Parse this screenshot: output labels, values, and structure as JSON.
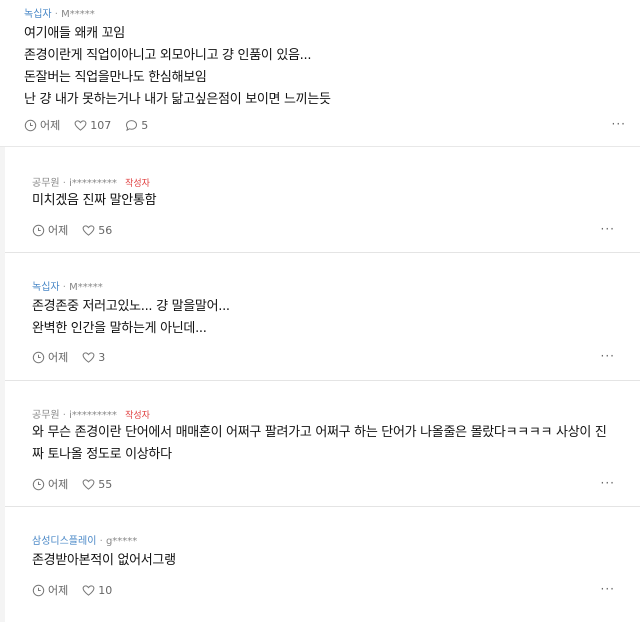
{
  "post_comment": {
    "company": "녹십자",
    "user": "M*****",
    "lines": [
      "여기애들 왜캐 꼬임",
      "존경이란게 직업이아니고 외모아니고 걍 인품이 있음...",
      "돈잘버는 직업을만나도 한심해보임",
      "난 걍 내가 못하는거나 내가 닮고싶은점이 보이면 느끼는듯"
    ],
    "time": "어제",
    "likes": "107",
    "replies": "5",
    "more": "···"
  },
  "replies": [
    {
      "company": "공무원",
      "user": "i*********",
      "author_tag": "작성자",
      "lines": [
        "미치겠음 진짜 말안통함"
      ],
      "time": "어제",
      "likes": "56",
      "more": "···"
    },
    {
      "company": "녹십자",
      "user": "M*****",
      "author_tag": "",
      "lines": [
        "존경존중 저러고있노... 걍 말을말어...",
        "완벽한 인간을 말하는게 아닌데..."
      ],
      "time": "어제",
      "likes": "3",
      "more": "···"
    },
    {
      "company": "공무원",
      "user": "i*********",
      "author_tag": "작성자",
      "lines": [
        "와 무슨 존경이란 단어에서 매매혼이 어쩌구 팔려가고 어쩌구 하는 단어가 나올줄은 몰랐다ㅋㅋㅋㅋ 사상이 진",
        "짜 토나올 정도로 이상하다"
      ],
      "time": "어제",
      "likes": "55",
      "more": "···"
    },
    {
      "company": "삼성디스플레이",
      "user": "g*****",
      "author_tag": "",
      "lines": [
        "존경받아본적이 없어서그랭"
      ],
      "time": "어제",
      "likes": "10",
      "more": "···"
    }
  ],
  "colors": {
    "company_link": "#4a88c7",
    "author_tag": "#e04040",
    "meta_gray": "#888888",
    "divider": "#e4e4e4"
  }
}
